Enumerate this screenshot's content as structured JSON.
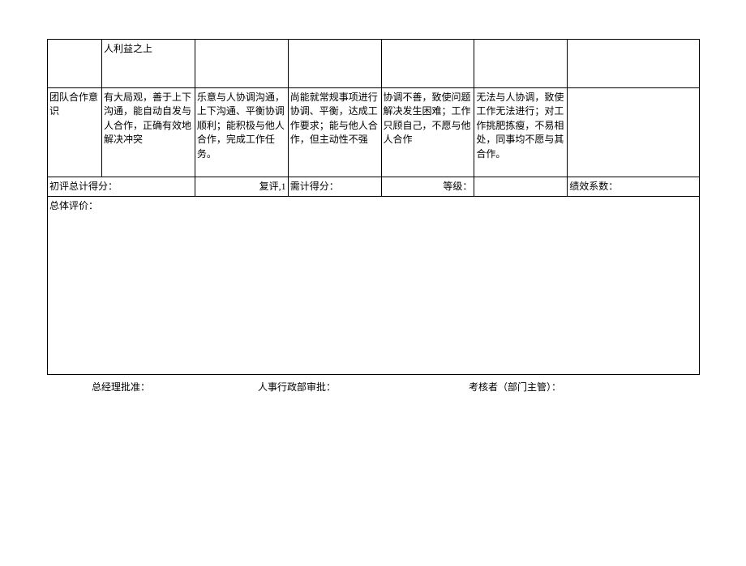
{
  "row1": {
    "c2": "人利益之上"
  },
  "row2": {
    "c1": "团队合作意识",
    "c2": "有大局观，善于上下沟通，能自动自发与人合作，正确有效地解决冲突",
    "c3": "乐意与人协调沟通，上下沟通、平衡协调顺利；能积极与他人合作，完成工作任务。",
    "c4": "尚能就常规事项进行协调、平衡，达成工作要求；能与他人合作，但主动性不强",
    "c5": "协调不善，致使问题解决发生困难；工作只顾自己，不愿与他人合作",
    "c6": "无法与人协调，致使工作无法进行；对工作挑肥拣瘦，不易相处，同事均不愿与其合作。"
  },
  "score_row": {
    "label1": "初评总计得分：",
    "label2": "复评,1",
    "label3": "需计得分：",
    "label4": "等级：",
    "label5": "绩效系数："
  },
  "eval_label": "总体评价：",
  "footer": {
    "f1": "总经理批准：",
    "f2": "人事行政部审批：",
    "f3": "考核者（部门主管）："
  }
}
